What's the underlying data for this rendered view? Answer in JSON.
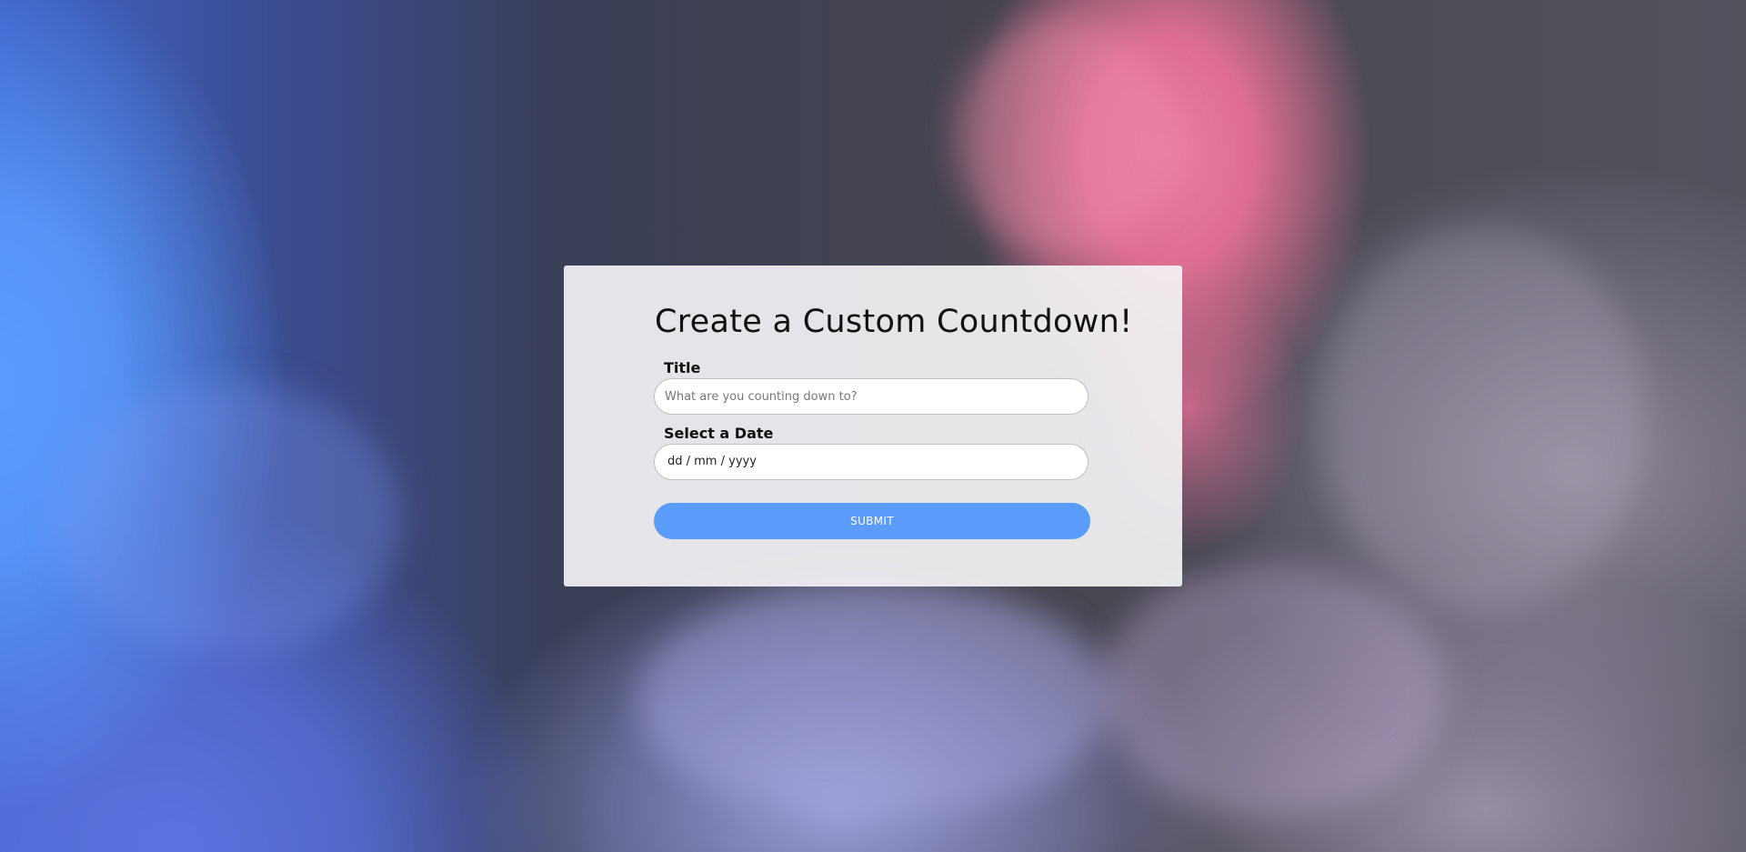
{
  "form": {
    "heading": "Create a Custom Countdown!",
    "title_label": "Title",
    "title_placeholder": "What are you counting down to?",
    "title_value": "",
    "date_label": "Select a Date",
    "date_placeholder": "dd / mm / yyyy",
    "submit_label": "SUBMIT"
  },
  "colors": {
    "accent": "#5b9bf9",
    "card_background": "#f2f2f4",
    "text": "#111111"
  }
}
